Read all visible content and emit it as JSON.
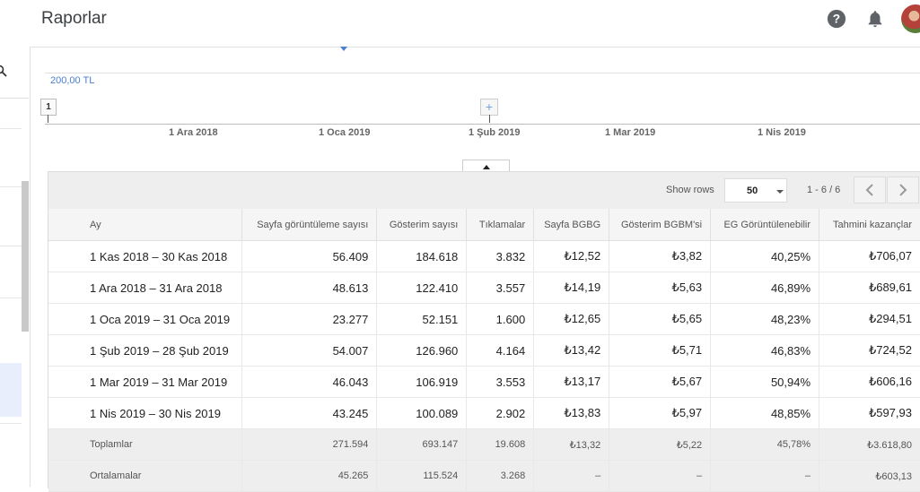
{
  "header": {
    "title": "Raporlar"
  },
  "icons": {
    "help": "help-circle-icon",
    "notifications": "bell-icon",
    "search": "search-icon"
  },
  "colors": {
    "accent": "#4a7fd6",
    "header_bg": "#f5f5f5",
    "summary_bg": "#eeeeee"
  },
  "chart": {
    "y_label": "200,00 TL",
    "annotation_1": "1",
    "annotation_add": "+",
    "x_ticks": [
      "1 Ara 2018",
      "1 Oca 2019",
      "1 Şub 2019",
      "1 Mar 2019",
      "1 Nis 2019"
    ]
  },
  "table_controls": {
    "show_rows_label": "Show rows",
    "rows_per_page": "50",
    "page_range": "1 - 6 / 6"
  },
  "table": {
    "columns": [
      "Ay",
      "Sayfa görüntüleme sayısı",
      "Gösterim sayısı",
      "Tıklamalar",
      "Sayfa BGBG",
      "Gösterim BGBM'si",
      "EG Görüntülenebilir",
      "Tahmini kazançlar"
    ],
    "rows": [
      [
        "1 Kas 2018 – 30 Kas 2018",
        "56.409",
        "184.618",
        "3.832",
        "₺12,52",
        "₺3,82",
        "40,25%",
        "₺706,07"
      ],
      [
        "1 Ara 2018 – 31 Ara 2018",
        "48.613",
        "122.410",
        "3.557",
        "₺14,19",
        "₺5,63",
        "46,89%",
        "₺689,61"
      ],
      [
        "1 Oca 2019 – 31 Oca 2019",
        "23.277",
        "52.151",
        "1.600",
        "₺12,65",
        "₺5,65",
        "48,23%",
        "₺294,51"
      ],
      [
        "1 Şub 2019 – 28 Şub 2019",
        "54.007",
        "126.960",
        "4.164",
        "₺13,42",
        "₺5,71",
        "46,83%",
        "₺724,52"
      ],
      [
        "1 Mar 2019 – 31 Mar 2019",
        "46.043",
        "106.919",
        "3.553",
        "₺13,17",
        "₺5,67",
        "50,94%",
        "₺606,16"
      ],
      [
        "1 Nis 2019 – 30 Nis 2019",
        "43.245",
        "100.089",
        "2.902",
        "₺13,83",
        "₺5,97",
        "48,85%",
        "₺597,93"
      ]
    ],
    "summary": [
      [
        "Toplamlar",
        "271.594",
        "693.147",
        "19.608",
        "₺13,32",
        "₺5,22",
        "45,78%",
        "₺3.618,80"
      ],
      [
        "Ortalamalar",
        "45.265",
        "115.524",
        "3.268",
        "–",
        "–",
        "–",
        "₺603,13"
      ]
    ]
  }
}
